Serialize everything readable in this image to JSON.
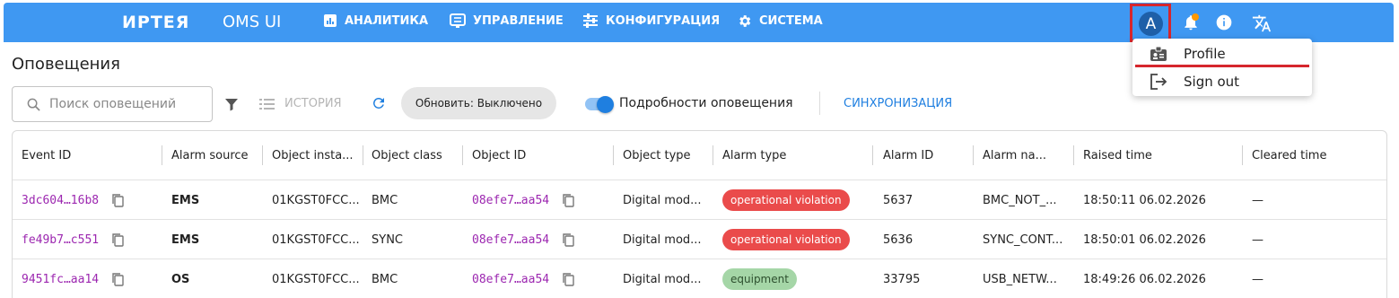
{
  "app": {
    "brand": "ИРТЕЯ",
    "name": "OMS UI",
    "nav": [
      {
        "label": "АНАЛИТИКА",
        "icon": "analytics-icon"
      },
      {
        "label": "УПРАВЛЕНИЕ",
        "icon": "management-icon"
      },
      {
        "label": "КОНФИГУРАЦИЯ",
        "icon": "tune-icon"
      },
      {
        "label": "СИСТЕМА",
        "icon": "gear-icon"
      }
    ],
    "avatar_letter": "A",
    "accent_color": "#3f98f2"
  },
  "user_menu": {
    "items": [
      {
        "label": "Profile",
        "icon": "badge-icon"
      },
      {
        "label": "Sign out",
        "icon": "logout-icon"
      }
    ]
  },
  "page": {
    "title": "Оповещения",
    "search_placeholder": "Поиск оповещений",
    "history_label": "ИСТОРИЯ",
    "refresh_chip": "Обновить: Выключено",
    "details_toggle_label": "Подробности оповещения",
    "details_toggle_on": true,
    "sync_label": "СИНХРОНИЗАЦИЯ"
  },
  "table": {
    "columns": [
      "Event ID",
      "Alarm source",
      "Object insta...",
      "Object class",
      "Object ID",
      "Object type",
      "Alarm type",
      "Alarm ID",
      "Alarm na...",
      "Raised time",
      "Cleared time"
    ],
    "rows": [
      {
        "event_id": "3dc604…16b8",
        "source": "EMS",
        "instance": "01KGST0FCC...",
        "class": "BMC",
        "object_id": "08efe7…aa54",
        "object_type": "Digital mod...",
        "alarm_type": "operational violation",
        "alarm_type_color": "red",
        "alarm_id": "5637",
        "alarm_name": "BMC_NOT_...",
        "raised": "18:50:11 06.02.2026",
        "cleared": "—"
      },
      {
        "event_id": "fe49b7…c551",
        "source": "EMS",
        "instance": "01KGST0FCC...",
        "class": "SYNC",
        "object_id": "08efe7…aa54",
        "object_type": "Digital mod...",
        "alarm_type": "operational violation",
        "alarm_type_color": "red",
        "alarm_id": "5636",
        "alarm_name": "SYNC_CONT...",
        "raised": "18:50:01 06.02.2026",
        "cleared": "—"
      },
      {
        "event_id": "9451fc…aa14",
        "source": "OS",
        "instance": "01KGST0FCC...",
        "class": "BMC",
        "object_id": "08efe7…aa54",
        "object_type": "Digital mod...",
        "alarm_type": "equipment",
        "alarm_type_color": "green",
        "alarm_id": "33795",
        "alarm_name": "USB_NETW...",
        "raised": "18:49:26 06.02.2026",
        "cleared": "—"
      }
    ]
  }
}
